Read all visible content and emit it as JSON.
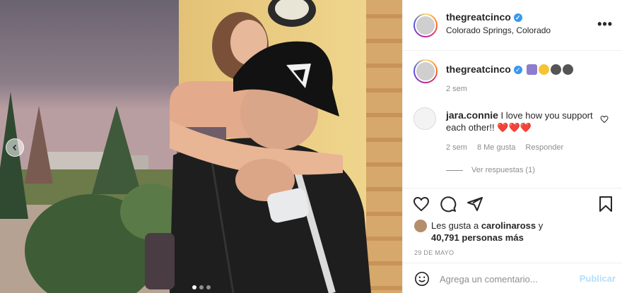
{
  "post": {
    "username": "thegreatcinco",
    "location": "Colorado Springs, Colorado",
    "more_label": "•••",
    "caption_time": "2 sem",
    "date": "29 DE MAYO"
  },
  "comment": {
    "username": "jara.connie",
    "text": "I love how you support each other!!",
    "hearts": "❤️❤️❤️",
    "time": "2 sem",
    "likes": "8 Me gusta",
    "reply_label": "Responder",
    "view_replies": "Ver respuestas (1)"
  },
  "likes": {
    "prefix": "Les gusta a ",
    "user": "carolinaross",
    "connector": " y",
    "count_text": "40,791 personas más"
  },
  "add_comment": {
    "placeholder": "Agrega un comentario...",
    "post_label": "Publicar"
  },
  "carousel": {
    "slides": 3,
    "active_index": 0
  },
  "icons": [
    "verified-badge-icon",
    "more-icon",
    "heart-icon",
    "comment-icon",
    "share-icon",
    "bookmark-icon",
    "smile-icon",
    "chevron-left-icon"
  ],
  "colors": {
    "verified": "#3897f0",
    "heart_red": "#e8324b",
    "post_button": "#b2dffc"
  }
}
